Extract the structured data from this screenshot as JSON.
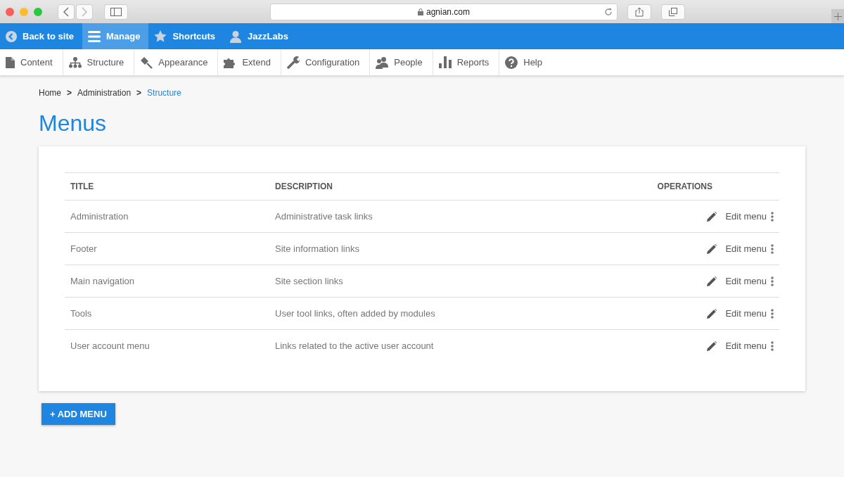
{
  "browser": {
    "address": "agnian.com"
  },
  "toolbar": [
    {
      "label": "Back to site",
      "kind": "back",
      "selected": false
    },
    {
      "label": "Manage",
      "kind": "menu",
      "selected": true
    },
    {
      "label": "Shortcuts",
      "kind": "star",
      "selected": false
    },
    {
      "label": "JazzLabs",
      "kind": "user",
      "selected": false
    }
  ],
  "tray": [
    {
      "label": "Content",
      "kind": "file"
    },
    {
      "label": "Structure",
      "kind": "tree"
    },
    {
      "label": "Appearance",
      "kind": "brush"
    },
    {
      "label": "Extend",
      "kind": "puzzle"
    },
    {
      "label": "Configuration",
      "kind": "wrench"
    },
    {
      "label": "People",
      "kind": "people"
    },
    {
      "label": "Reports",
      "kind": "bars"
    },
    {
      "label": "Help",
      "kind": "help"
    }
  ],
  "breadcrumb": {
    "items": [
      "Home",
      "Administration",
      "Structure"
    ],
    "separator": ">"
  },
  "page_title": "Menus",
  "table": {
    "columns": [
      "TITLE",
      "DESCRIPTION",
      "OPERATIONS"
    ],
    "rows": [
      {
        "title": "Administration",
        "description": "Administrative task links",
        "operation": "Edit menu"
      },
      {
        "title": "Footer",
        "description": "Site information links",
        "operation": "Edit menu"
      },
      {
        "title": "Main navigation",
        "description": "Site section links",
        "operation": "Edit menu"
      },
      {
        "title": "Tools",
        "description": "User tool links, often added by modules",
        "operation": "Edit menu"
      },
      {
        "title": "User account menu",
        "description": "Links related to the active user account",
        "operation": "Edit menu"
      }
    ]
  },
  "add_button": "+ ADD MENU"
}
